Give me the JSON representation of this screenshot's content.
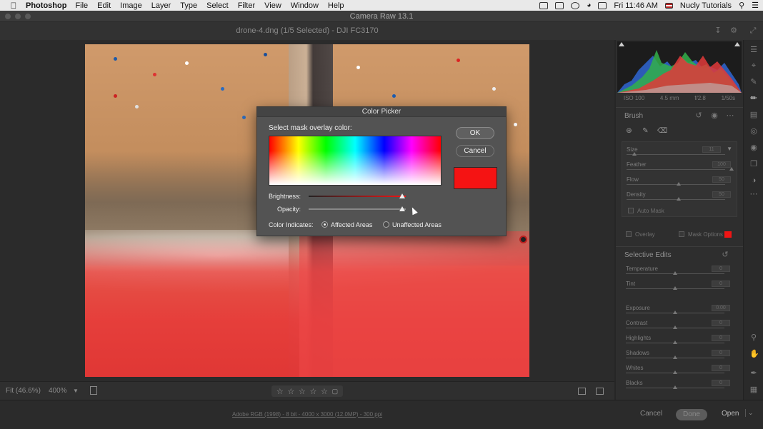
{
  "menubar": {
    "apple_icon": "apple-logo",
    "app_name": "Photoshop",
    "items": [
      "File",
      "Edit",
      "Image",
      "Layer",
      "Type",
      "Select",
      "Filter",
      "View",
      "Window",
      "Help"
    ],
    "clock": "Fri 11:46 AM",
    "user": "Nucly Tutorials"
  },
  "window": {
    "title": "Camera Raw 13.1"
  },
  "header": {
    "file_title": "drone-4.dng (1/5 Selected)  -  DJI FC3170"
  },
  "canvas_toolbar": {
    "fit_label": "Fit (46.6%)",
    "zoom_label": "400%",
    "rating_stars": [
      "☆",
      "☆",
      "☆",
      "☆",
      "☆"
    ]
  },
  "status": {
    "workflow_link": "Adobe RGB (1998) - 8 bit - 4000 x 3000 (12.0MP) - 300 ppi",
    "cancel_label": "Cancel",
    "done_label": "Done",
    "open_label": "Open"
  },
  "histogram": {
    "iso": "ISO 100",
    "focal": "4.5 mm",
    "aperture": "f/2.8",
    "shutter": "1/50s"
  },
  "brush_panel": {
    "title": "Brush",
    "sliders": [
      {
        "label": "Size",
        "value": "11"
      },
      {
        "label": "Feather",
        "value": "100"
      },
      {
        "label": "Flow",
        "value": "50"
      },
      {
        "label": "Density",
        "value": "50"
      }
    ],
    "auto_mask_label": "Auto Mask",
    "overlay_label": "Overlay",
    "mask_options_label": "Mask Options",
    "mask_color": "#f01414"
  },
  "selective_edits": {
    "title": "Selective Edits",
    "sliders": [
      {
        "label": "Temperature",
        "value": "0"
      },
      {
        "label": "Tint",
        "value": "0"
      },
      {
        "label": "Exposure",
        "value": "0.00"
      },
      {
        "label": "Contrast",
        "value": "0"
      },
      {
        "label": "Highlights",
        "value": "0"
      },
      {
        "label": "Shadows",
        "value": "0"
      },
      {
        "label": "Whites",
        "value": "0"
      },
      {
        "label": "Blacks",
        "value": "0"
      }
    ]
  },
  "color_picker": {
    "title": "Color Picker",
    "prompt": "Select mask overlay color:",
    "ok_label": "OK",
    "cancel_label": "Cancel",
    "brightness_label": "Brightness:",
    "opacity_label": "Opacity:",
    "indicates_label": "Color Indicates:",
    "affected_label": "Affected Areas",
    "unaffected_label": "Unaffected Areas",
    "selected_option": "Affected Areas",
    "selected_color": "#f51313",
    "brightness_fraction": 0.96,
    "opacity_fraction": 0.96
  }
}
